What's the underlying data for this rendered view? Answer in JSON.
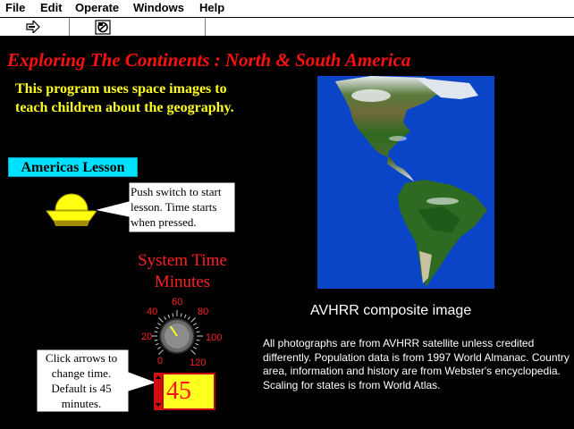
{
  "menu": {
    "items": [
      "File",
      "Edit",
      "Operate",
      "Windows",
      "Help"
    ]
  },
  "toolbar": {
    "run_icon": "run-arrow-icon",
    "stop_icon": "abort-icon"
  },
  "page": {
    "title": "Exploring The Continents : North & South America",
    "intro": "This program uses space images to teach children about the geography."
  },
  "lesson": {
    "button_label": "Americas Lesson",
    "switch_note": "Push switch to start lesson.  Time starts when pressed."
  },
  "timer": {
    "title_line1": "System Time",
    "title_line2": "Minutes",
    "dial_ticks": [
      "0",
      "20",
      "40",
      "60",
      "80",
      "100",
      "120"
    ],
    "dial_value": 45,
    "dial_max": 120,
    "note": "Click arrows to change time. Default is 45 minutes.",
    "display_value": "45"
  },
  "image": {
    "caption": "AVHRR composite image"
  },
  "credits": {
    "text": "All photographs are from AVHRR satellite unless credited differently.  Population data is from 1997 World Almanac. Country area, information and history are from Webster's encyclopedia.  Scaling for states is from  World Atlas."
  },
  "colors": {
    "title": "#ff1010",
    "intro": "#ffff20",
    "lesson_button": "#00e0ff",
    "ocean": "#0a45c8"
  }
}
